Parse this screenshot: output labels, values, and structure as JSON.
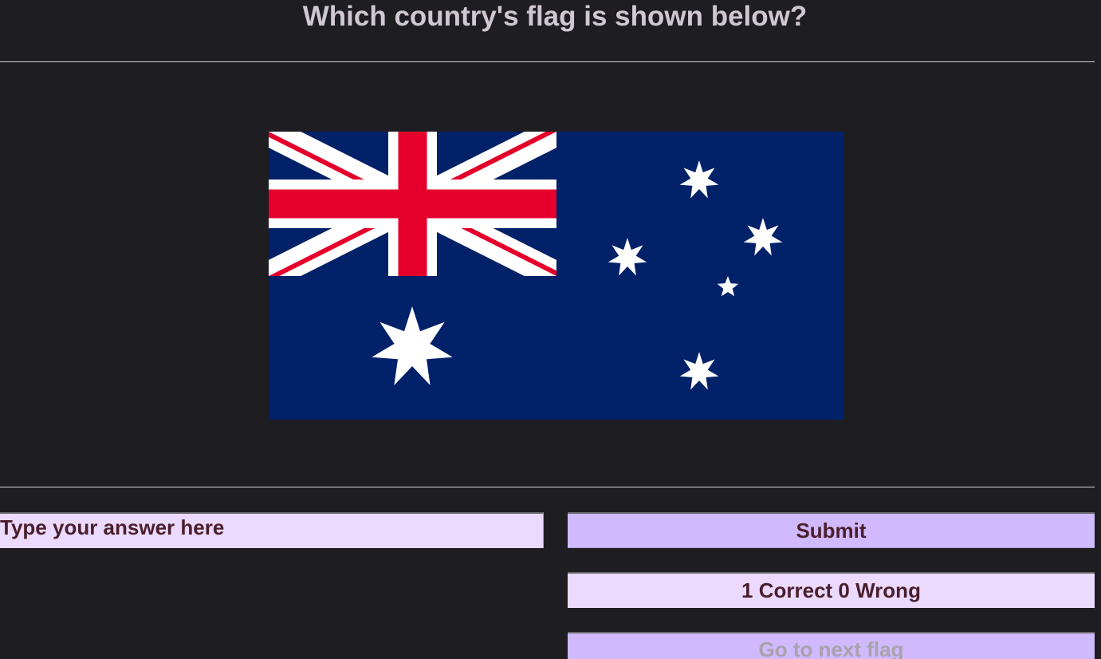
{
  "quiz": {
    "question": "Which country's flag is shown below?"
  },
  "flag": {
    "colors": {
      "blue": "#012169",
      "red": "#e4002b",
      "white": "#ffffff"
    }
  },
  "answer": {
    "value": "",
    "placeholder": "Type your answer here"
  },
  "buttons": {
    "submit_label": "Submit",
    "next_label": "Go to next flag"
  },
  "score": {
    "text": "1 Correct 0 Wrong"
  }
}
